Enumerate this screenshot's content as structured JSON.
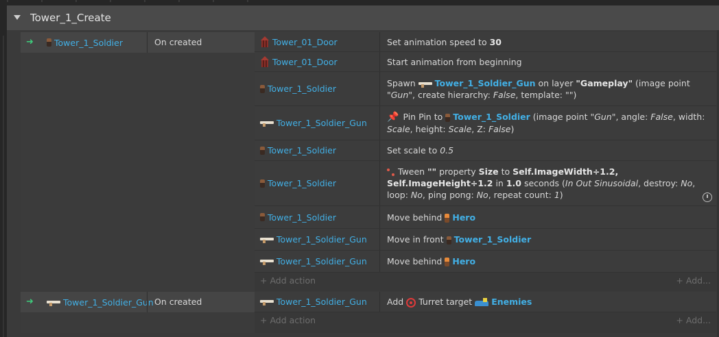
{
  "group": {
    "title": "Tower_1_Create"
  },
  "events": [
    {
      "trigger_object": "Tower_1_Soldier",
      "condition": "On created",
      "actions": [
        {
          "object": "Tower_01_Door",
          "icon": "door-icon",
          "parts": [
            {
              "t": "Set animation speed to "
            },
            {
              "t": "30",
              "s": "b"
            }
          ]
        },
        {
          "object": "Tower_01_Door",
          "icon": "door-icon",
          "parts": [
            {
              "t": "Start animation from beginning"
            }
          ]
        },
        {
          "object": "Tower_1_Soldier",
          "icon": "soldier-icon",
          "parts": [
            {
              "t": "Spawn "
            },
            {
              "icon": "gun-icon"
            },
            {
              "t": "Tower_1_Soldier_Gun",
              "s": "ob"
            },
            {
              "t": " on layer "
            },
            {
              "t": "\"Gameplay\"",
              "s": "b"
            },
            {
              "t": " (image point "
            },
            {
              "t": "\"Gun\"",
              "s": "i"
            },
            {
              "t": ", create hierarchy: "
            },
            {
              "t": "False",
              "s": "i"
            },
            {
              "t": ", template: "
            },
            {
              "t": "\"\"",
              "s": "i"
            },
            {
              "t": ")"
            }
          ]
        },
        {
          "object": "Tower_1_Soldier_Gun",
          "icon": "gun-icon",
          "parts": [
            {
              "icon": "pin-icon"
            },
            {
              "t": "Pin Pin to "
            },
            {
              "icon": "soldier-icon"
            },
            {
              "t": "Tower_1_Soldier",
              "s": "ob"
            },
            {
              "t": " (image point "
            },
            {
              "t": "\"Gun\"",
              "s": "i"
            },
            {
              "t": ", angle: "
            },
            {
              "t": "False",
              "s": "i"
            },
            {
              "t": ", width: "
            },
            {
              "t": "Scale",
              "s": "i"
            },
            {
              "t": ", height: "
            },
            {
              "t": "Scale",
              "s": "i"
            },
            {
              "t": ", Z: "
            },
            {
              "t": "False",
              "s": "i"
            },
            {
              "t": ")"
            }
          ]
        },
        {
          "object": "Tower_1_Soldier",
          "icon": "soldier-icon",
          "parts": [
            {
              "t": "Set scale to "
            },
            {
              "t": "0.5",
              "s": "i"
            }
          ]
        },
        {
          "object": "Tower_1_Soldier",
          "icon": "soldier-icon",
          "has_reset": true,
          "parts": [
            {
              "icon": "tween-icon"
            },
            {
              "t": "Tween "
            },
            {
              "t": "\"\"",
              "s": "b"
            },
            {
              "t": " property "
            },
            {
              "t": "Size",
              "s": "b"
            },
            {
              "t": " to "
            },
            {
              "t": "Self.ImageWidth÷1.2, Self.ImageHeight÷1.2",
              "s": "b"
            },
            {
              "t": " in "
            },
            {
              "t": "1.0",
              "s": "b"
            },
            {
              "t": "  seconds ("
            },
            {
              "t": "In Out Sinusoidal",
              "s": "i"
            },
            {
              "t": ", destroy: "
            },
            {
              "t": "No",
              "s": "i"
            },
            {
              "t": ", loop: "
            },
            {
              "t": "No",
              "s": "i"
            },
            {
              "t": ", ping pong: "
            },
            {
              "t": "No",
              "s": "i"
            },
            {
              "t": ", repeat count: "
            },
            {
              "t": "1",
              "s": "i"
            },
            {
              "t": ")"
            }
          ]
        },
        {
          "object": "Tower_1_Soldier",
          "icon": "soldier-icon",
          "parts": [
            {
              "t": "Move behind "
            },
            {
              "icon": "hero-icon"
            },
            {
              "t": "Hero",
              "s": "ob"
            }
          ]
        },
        {
          "object": "Tower_1_Soldier_Gun",
          "icon": "gun-icon",
          "parts": [
            {
              "t": "Move in front "
            },
            {
              "icon": "soldier-icon"
            },
            {
              "t": "Tower_1_Soldier",
              "s": "ob"
            }
          ]
        },
        {
          "object": "Tower_1_Soldier_Gun",
          "icon": "gun-icon",
          "parts": [
            {
              "t": "Move behind "
            },
            {
              "icon": "hero-icon"
            },
            {
              "t": "Hero",
              "s": "ob"
            }
          ]
        }
      ],
      "add_action_label": "+ Add action",
      "add_more_label": "+ Add..."
    },
    {
      "trigger_object": "Tower_1_Soldier_Gun",
      "condition": "On created",
      "actions": [
        {
          "object": "Tower_1_Soldier_Gun",
          "icon": "gun-icon",
          "parts": [
            {
              "t": "Add "
            },
            {
              "icon": "turret-icon"
            },
            {
              "t": "Turret target "
            },
            {
              "icon": "enemies-icon"
            },
            {
              "t": "Enemies",
              "s": "ob"
            }
          ]
        }
      ],
      "add_action_label": "+ Add action",
      "add_more_label": "+ Add..."
    }
  ]
}
